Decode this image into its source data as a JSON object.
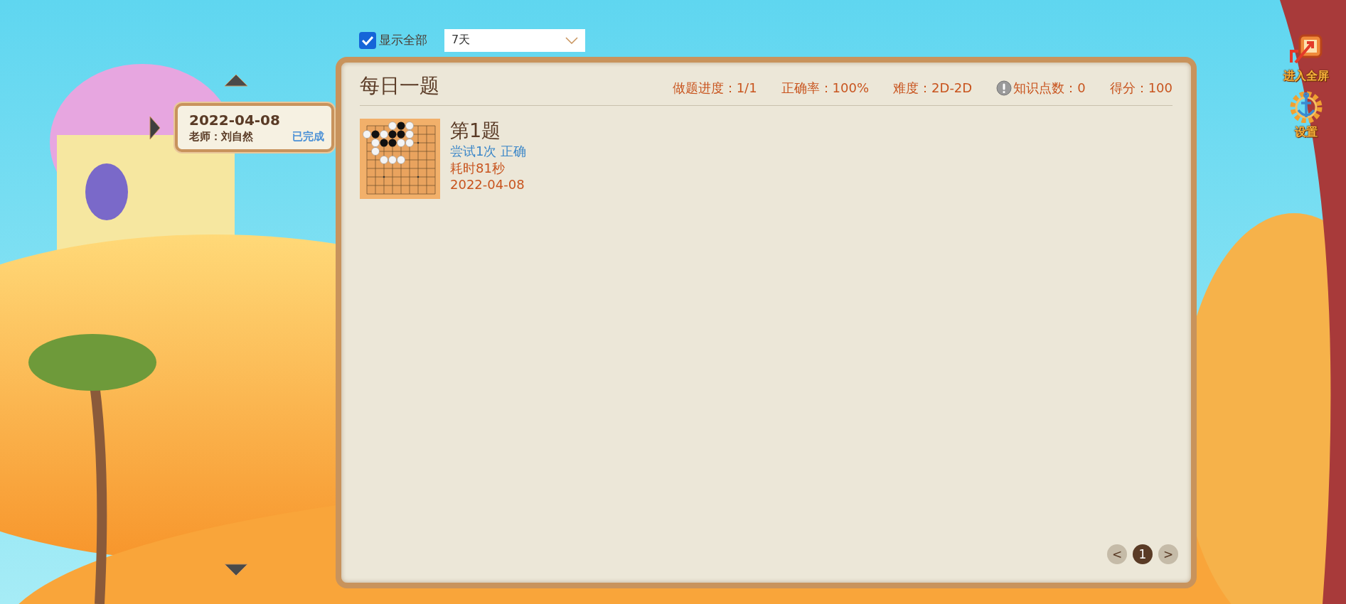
{
  "toolbar": {
    "show_all": {
      "label": "显示全部",
      "checked": true
    },
    "range_select": {
      "value": "7天"
    }
  },
  "date_list": [
    {
      "date": "2022-04-08",
      "teacher": "老师：刘自然",
      "status": "已完成",
      "selected": true
    }
  ],
  "panel": {
    "title": "每日一题",
    "stats": [
      {
        "text": "做题进度：1/1",
        "hint_icon": false
      },
      {
        "text": "正确率：100%",
        "hint_icon": false
      },
      {
        "text": "难度：2D-2D",
        "hint_icon": false
      },
      {
        "text": "知识点数：0",
        "hint_icon": true
      },
      {
        "text": "得分：100",
        "hint_icon": false
      }
    ],
    "problems": [
      {
        "title": "第1题",
        "result": "尝试1次 正确",
        "time": "耗时81秒",
        "date": "2022-04-08"
      }
    ],
    "pagination": {
      "prev": "<",
      "next": ">",
      "pages": [
        {
          "label": "1",
          "selected": true
        }
      ]
    }
  },
  "side_buttons": [
    {
      "label": "进入全屏",
      "kind": "fullscreen"
    },
    {
      "label": "设置",
      "kind": "settings"
    }
  ]
}
